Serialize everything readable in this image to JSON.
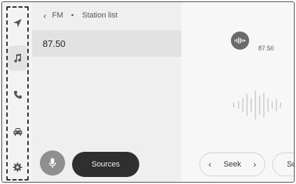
{
  "sidebar": {
    "items": [
      {
        "icon": "navigation-arrow-icon"
      },
      {
        "icon": "music-note-icon",
        "active": true
      },
      {
        "icon": "phone-icon"
      },
      {
        "icon": "car-icon"
      },
      {
        "icon": "settings-gear-icon"
      }
    ]
  },
  "header": {
    "back_glyph": "‹",
    "source": "FM",
    "page": "Station list"
  },
  "stations": [
    {
      "frequency": "87.50"
    }
  ],
  "now_playing": {
    "frequency": "87.50",
    "station_icon": "radio-signal-icon"
  },
  "controls": {
    "mic_icon": "microphone-icon",
    "sources_label": "Sources",
    "seek_label": "Seek",
    "seek_prev_glyph": "‹",
    "seek_next_glyph": "›",
    "scan_label": "Sca"
  }
}
